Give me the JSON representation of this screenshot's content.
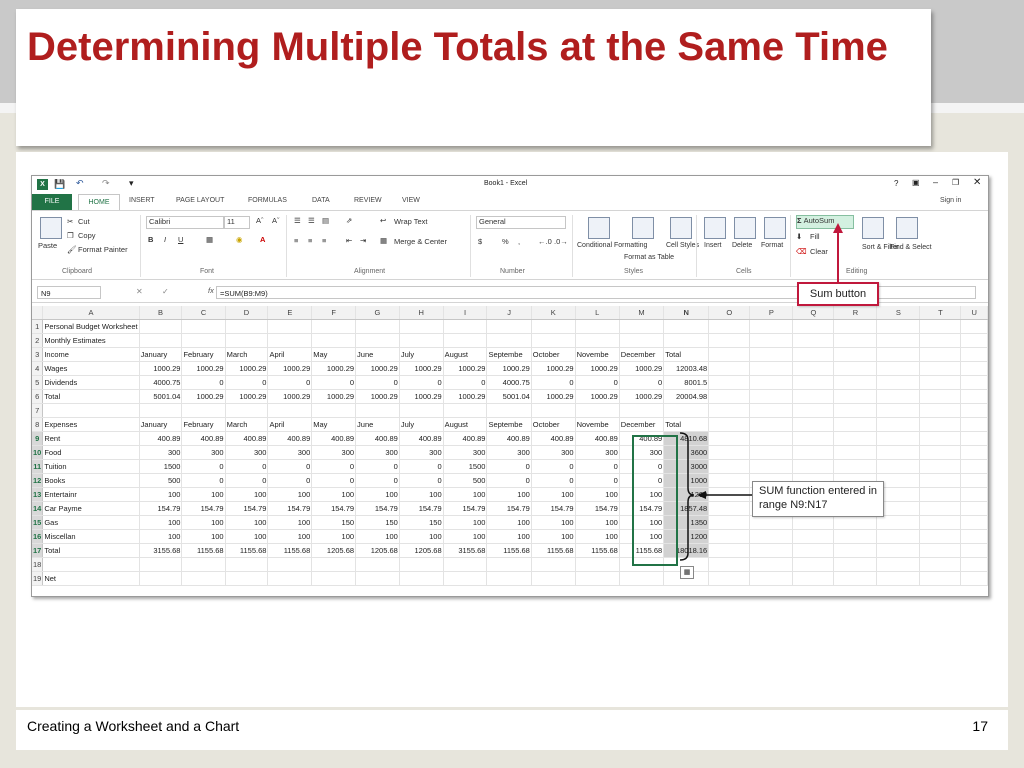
{
  "slide": {
    "title": "Determining Multiple Totals at the Same Time",
    "footer_text": "Creating a Worksheet and a Chart",
    "page_number": "17"
  },
  "excel": {
    "window_title": "Book1 - Excel",
    "title_right": "?",
    "tabs": [
      "FILE",
      "HOME",
      "INSERT",
      "PAGE LAYOUT",
      "FORMULAS",
      "DATA",
      "REVIEW",
      "VIEW"
    ],
    "sign_in": "Sign in",
    "ribbon": {
      "cut": "Cut",
      "copy": "Copy",
      "paste": "Paste",
      "format_painter": "Format Painter",
      "clipboard_label": "Clipboard",
      "font_name": "Calibri",
      "font_size": "11",
      "font_label": "Font",
      "wrap_text": "Wrap Text",
      "merge_center": "Merge & Center",
      "alignment_label": "Alignment",
      "number_format": "General",
      "number_label": "Number",
      "conditional_formatting": "Conditional Formatting",
      "format_as_table": "Format as Table",
      "cell_styles": "Cell Styles",
      "styles_label": "Styles",
      "insert": "Insert",
      "delete": "Delete",
      "format": "Format",
      "cells_label": "Cells",
      "autosum": "AutoSum",
      "fill": "Fill",
      "clear": "Clear",
      "sort_filter": "Sort & Filter",
      "find_select": "Find & Select",
      "editing_label": "Editing"
    },
    "name_box": "N9",
    "formula": "=SUM(B9:M9)",
    "columns": [
      "A",
      "B",
      "C",
      "D",
      "E",
      "F",
      "G",
      "H",
      "I",
      "J",
      "K",
      "L",
      "M",
      "N",
      "O",
      "P",
      "Q",
      "R",
      "S",
      "T",
      "U"
    ],
    "rows": [
      [
        "1",
        "Personal Budget Worksheet",
        "",
        "",
        "",
        "",
        "",
        "",
        "",
        "",
        "",
        "",
        "",
        ""
      ],
      [
        "2",
        "Monthly Estimates",
        "",
        "",
        "",
        "",
        "",
        "",
        "",
        "",
        "",
        "",
        "",
        ""
      ],
      [
        "3",
        "Income",
        "January",
        "February",
        "March",
        "April",
        "May",
        "June",
        "July",
        "August",
        "Septembe",
        "October",
        "Novembe",
        "December",
        "Total"
      ],
      [
        "4",
        "Wages",
        "1000.29",
        "1000.29",
        "1000.29",
        "1000.29",
        "1000.29",
        "1000.29",
        "1000.29",
        "1000.29",
        "1000.29",
        "1000.29",
        "1000.29",
        "1000.29",
        "12003.48"
      ],
      [
        "5",
        "Dividends",
        "4000.75",
        "0",
        "0",
        "0",
        "0",
        "0",
        "0",
        "0",
        "4000.75",
        "0",
        "0",
        "0",
        "8001.5"
      ],
      [
        "6",
        "Total",
        "5001.04",
        "1000.29",
        "1000.29",
        "1000.29",
        "1000.29",
        "1000.29",
        "1000.29",
        "1000.29",
        "5001.04",
        "1000.29",
        "1000.29",
        "1000.29",
        "20004.98"
      ],
      [
        "7",
        "",
        "",
        "",
        "",
        "",
        "",
        "",
        "",
        "",
        "",
        "",
        "",
        ""
      ],
      [
        "8",
        "Expenses",
        "January",
        "February",
        "March",
        "April",
        "May",
        "June",
        "July",
        "August",
        "Septembe",
        "October",
        "Novembe",
        "December",
        "Total"
      ],
      [
        "9",
        "Rent",
        "400.89",
        "400.89",
        "400.89",
        "400.89",
        "400.89",
        "400.89",
        "400.89",
        "400.89",
        "400.89",
        "400.89",
        "400.89",
        "400.89",
        "4810.68"
      ],
      [
        "10",
        "Food",
        "300",
        "300",
        "300",
        "300",
        "300",
        "300",
        "300",
        "300",
        "300",
        "300",
        "300",
        "300",
        "3600"
      ],
      [
        "11",
        "Tuition",
        "1500",
        "0",
        "0",
        "0",
        "0",
        "0",
        "0",
        "1500",
        "0",
        "0",
        "0",
        "0",
        "3000"
      ],
      [
        "12",
        "Books",
        "500",
        "0",
        "0",
        "0",
        "0",
        "0",
        "0",
        "500",
        "0",
        "0",
        "0",
        "0",
        "1000"
      ],
      [
        "13",
        "Entertainr",
        "100",
        "100",
        "100",
        "100",
        "100",
        "100",
        "100",
        "100",
        "100",
        "100",
        "100",
        "100",
        "1200"
      ],
      [
        "14",
        "Car Payme",
        "154.79",
        "154.79",
        "154.79",
        "154.79",
        "154.79",
        "154.79",
        "154.79",
        "154.79",
        "154.79",
        "154.79",
        "154.79",
        "154.79",
        "1857.48"
      ],
      [
        "15",
        "Gas",
        "100",
        "100",
        "100",
        "100",
        "150",
        "150",
        "150",
        "100",
        "100",
        "100",
        "100",
        "100",
        "1350"
      ],
      [
        "16",
        "Miscellan",
        "100",
        "100",
        "100",
        "100",
        "100",
        "100",
        "100",
        "100",
        "100",
        "100",
        "100",
        "100",
        "1200"
      ],
      [
        "17",
        "Total",
        "3155.68",
        "1155.68",
        "1155.68",
        "1155.68",
        "1205.68",
        "1205.68",
        "1205.68",
        "3155.68",
        "1155.68",
        "1155.68",
        "1155.68",
        "1155.68",
        "18018.16"
      ],
      [
        "18",
        "",
        "",
        "",
        "",
        "",
        "",
        "",
        "",
        "",
        "",
        "",
        "",
        ""
      ],
      [
        "19",
        "Net",
        "",
        "",
        "",
        "",
        "",
        "",
        "",
        "",
        "",
        "",
        "",
        ""
      ]
    ]
  },
  "callouts": {
    "sum_button": "Sum button",
    "sum_function": "SUM function entered in range N9:N17"
  },
  "colors": {
    "title_red": "#b01e1e",
    "excel_green": "#217346",
    "callout_red": "#c0183c"
  }
}
